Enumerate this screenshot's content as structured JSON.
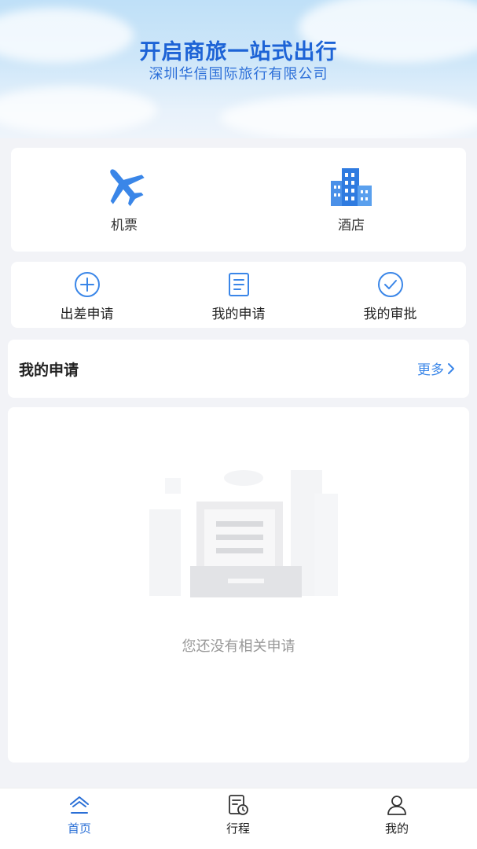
{
  "banner": {
    "title": "开启商旅一站式出行",
    "subtitle": "深圳华信国际旅行有限公司"
  },
  "main_services": [
    {
      "label": "机票",
      "icon": "airplane-icon"
    },
    {
      "label": "酒店",
      "icon": "hotel-building-icon"
    }
  ],
  "quick_actions": [
    {
      "label": "出差申请",
      "icon": "plus-circle-icon"
    },
    {
      "label": "我的申请",
      "icon": "document-list-icon"
    },
    {
      "label": "我的审批",
      "icon": "check-circle-icon"
    }
  ],
  "my_applications": {
    "title": "我的申请",
    "more_label": "更多",
    "empty_text": "您还没有相关申请"
  },
  "tabbar": [
    {
      "label": "首页",
      "icon": "home-icon",
      "active": true
    },
    {
      "label": "行程",
      "icon": "itinerary-icon",
      "active": false
    },
    {
      "label": "我的",
      "icon": "user-icon",
      "active": false
    }
  ],
  "colors": {
    "accent": "#2a6fd6",
    "icon_blue": "#3a86e8",
    "background": "#f2f3f7"
  }
}
